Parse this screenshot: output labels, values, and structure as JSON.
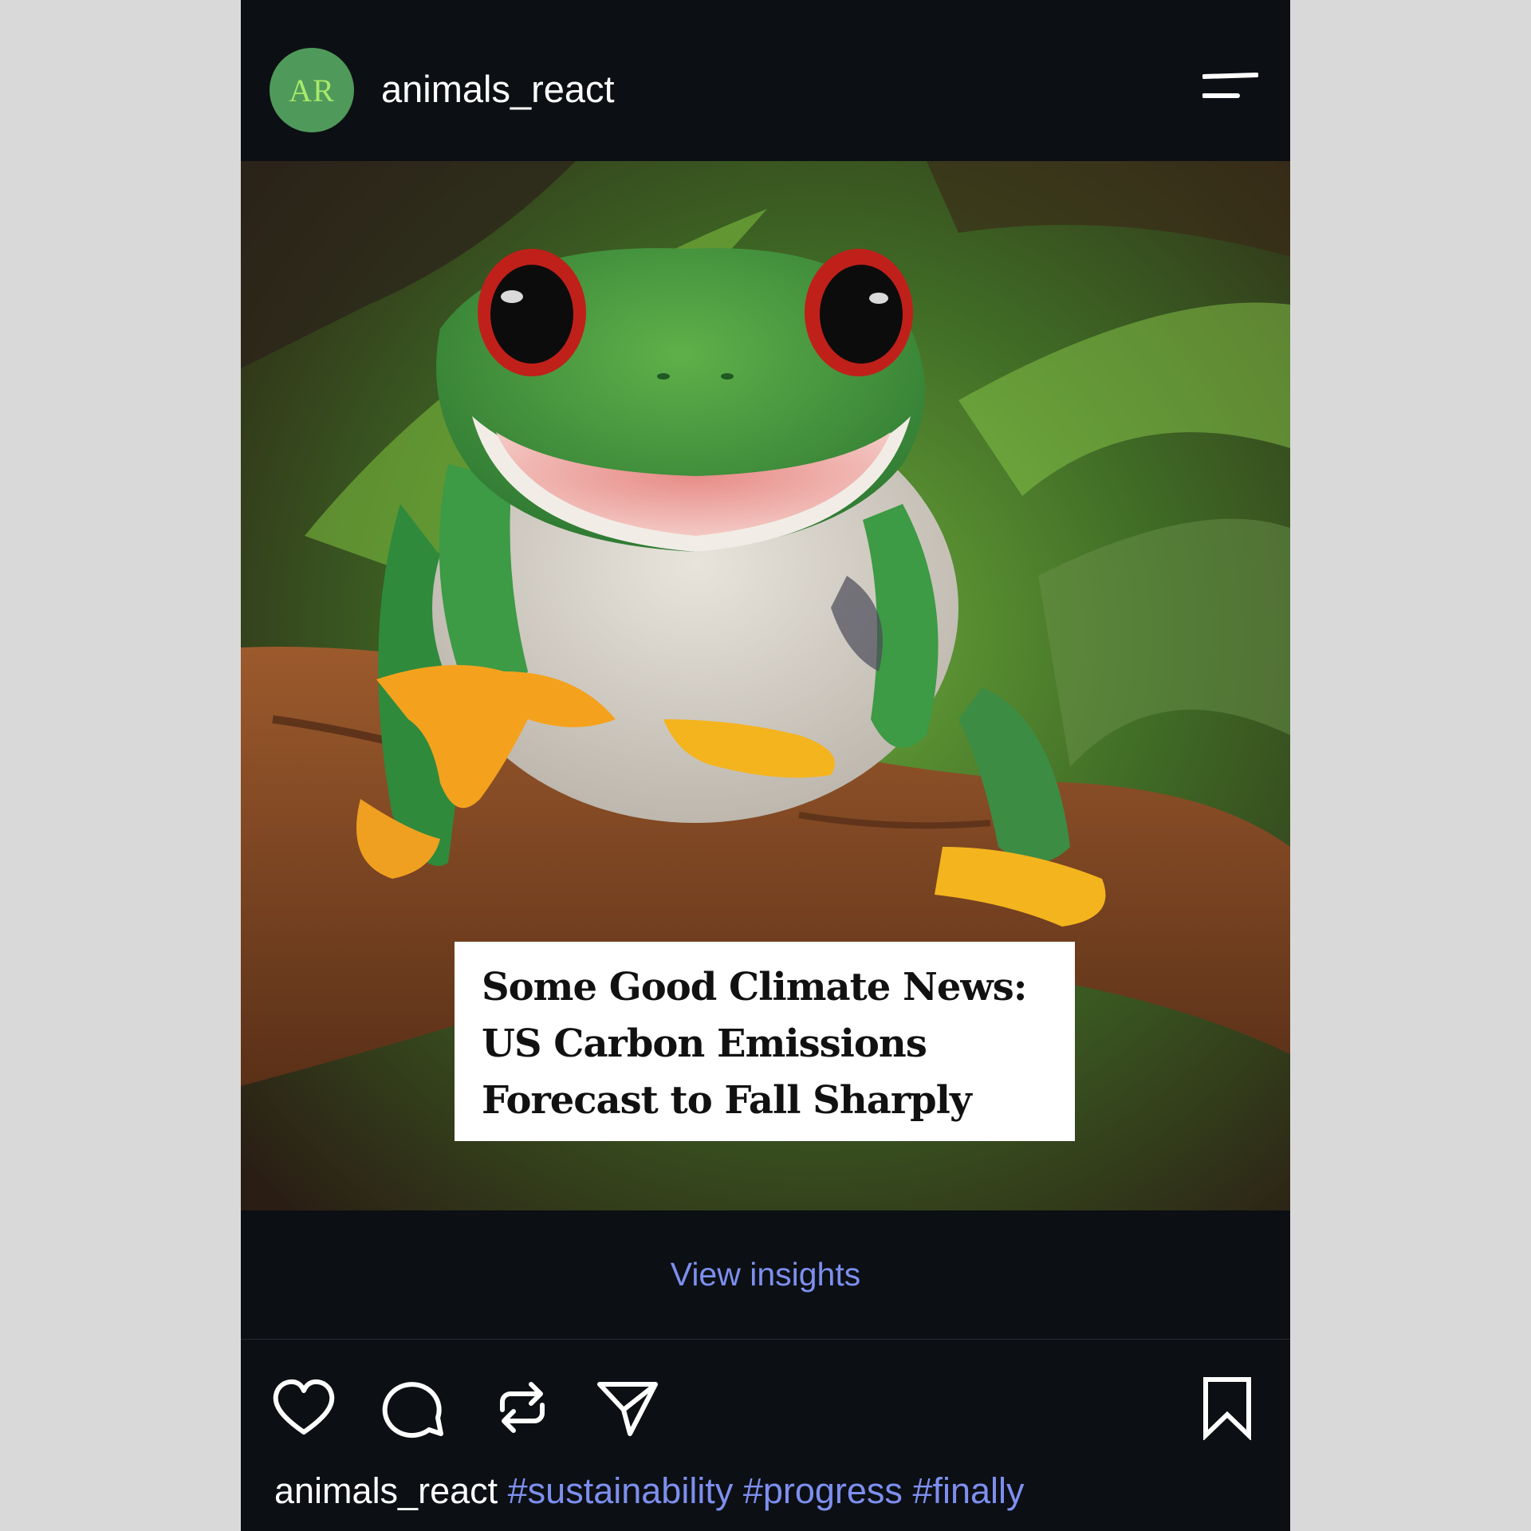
{
  "header": {
    "avatar_initials": "AR",
    "username": "animals_react",
    "menu_icon": "menu-icon"
  },
  "post": {
    "image_subject": "red-eyed tree frog smiling on a branch",
    "headline_lines": [
      "Some Good Climate News:",
      "US Carbon Emissions",
      "Forecast to Fall Sharply"
    ],
    "insights_label": "View insights"
  },
  "actions": {
    "icons": [
      "heart-icon",
      "comment-icon",
      "repost-icon",
      "share-icon",
      "bookmark-icon"
    ]
  },
  "caption": {
    "username": "animals_react",
    "hashtags": [
      "#sustainability",
      "#progress",
      "#finally"
    ]
  },
  "colors": {
    "background": "#d9d9d9",
    "card": "#0c0f14",
    "accent": "#7d8fee",
    "avatar": "#4f9a5a"
  }
}
